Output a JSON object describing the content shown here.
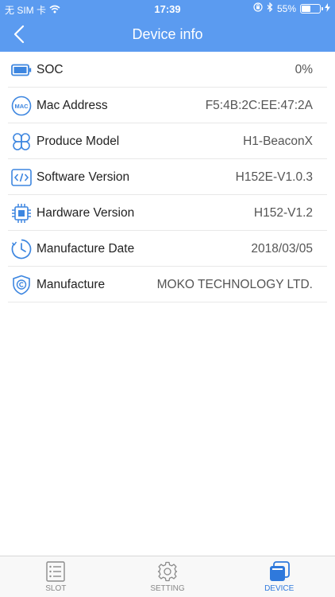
{
  "status_bar": {
    "carrier": "无 SIM 卡",
    "time": "17:39",
    "battery_percent": "55%",
    "battery_level": 0.55,
    "icons": [
      "wifi-icon",
      "orientation-lock-icon",
      "bluetooth-icon",
      "battery-icon",
      "charging-bolt-icon"
    ]
  },
  "nav": {
    "title": "Device info",
    "back_icon": "chevron-left-icon"
  },
  "rows": [
    {
      "icon": "battery-icon",
      "label": "SOC",
      "value": "0%"
    },
    {
      "icon": "mac-icon",
      "label": "Mac Address",
      "value": "F5:4B:2C:EE:47:2A"
    },
    {
      "icon": "model-icon",
      "label": "Produce Model",
      "value": "H1-BeaconX"
    },
    {
      "icon": "code-icon",
      "label": "Software Version",
      "value": "H152E-V1.0.3"
    },
    {
      "icon": "chip-icon",
      "label": "Hardware Version",
      "value": "H152-V1.2"
    },
    {
      "icon": "clock-icon",
      "label": "Manufacture Date",
      "value": "2018/03/05"
    },
    {
      "icon": "copyright-shield-icon",
      "label": "Manufacture",
      "value": "MOKO TECHNOLOGY LTD."
    }
  ],
  "tabs": [
    {
      "label": "SLOT",
      "icon": "list-icon",
      "active": false
    },
    {
      "label": "SETTING",
      "icon": "gear-icon",
      "active": false
    },
    {
      "label": "DEVICE",
      "icon": "device-icon",
      "active": true
    }
  ],
  "colors": {
    "brand": "#5b9bf0",
    "icon": "#3d86e0",
    "active_tab": "#2f79dc"
  },
  "mac_icon_text": "MAC"
}
